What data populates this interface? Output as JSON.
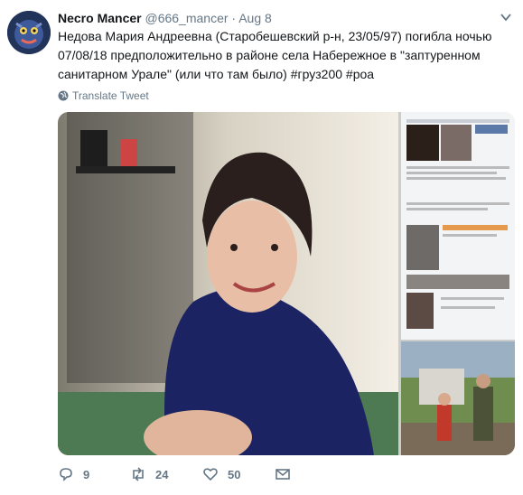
{
  "tweet": {
    "display_name": "Necro Mancer",
    "handle": "@666_mancer",
    "separator": "·",
    "time": "Aug 8",
    "text": "Недова Мария Андреевна (Старобешевский р-н, 23/05/97) погибла ночью 07/08/18 предположительно в районе села Набережное в \"заптуренном санитарном Урале\" (или что там было) #груз200 #роа",
    "translate_label": "Translate Tweet",
    "avatar_icon": "creature-avatar-icon",
    "caret_icon": "chevron-down-icon"
  },
  "actions": {
    "reply_count": "9",
    "retweet_count": "24",
    "like_count": "50",
    "reply_icon": "reply-icon",
    "retweet_icon": "retweet-icon",
    "like_icon": "heart-icon",
    "dm_icon": "envelope-icon"
  },
  "colors": {
    "text_primary": "#14171a",
    "text_secondary": "#657786",
    "background": "#ffffff"
  }
}
